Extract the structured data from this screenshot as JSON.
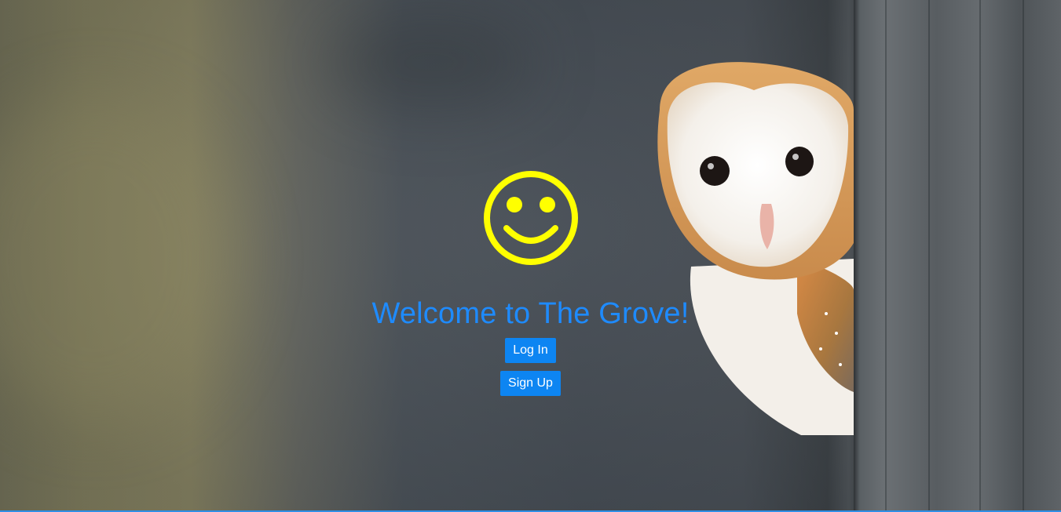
{
  "page": {
    "title": "Welcome to The Grove!",
    "smiley_color": "#ffff00",
    "title_color": "#1e8bff",
    "button_color": "#0d85f2"
  },
  "buttons": {
    "login_label": "Log In",
    "signup_label": "Sign Up"
  },
  "icons": {
    "logo": "smiley-icon",
    "background": "owl-photo"
  }
}
